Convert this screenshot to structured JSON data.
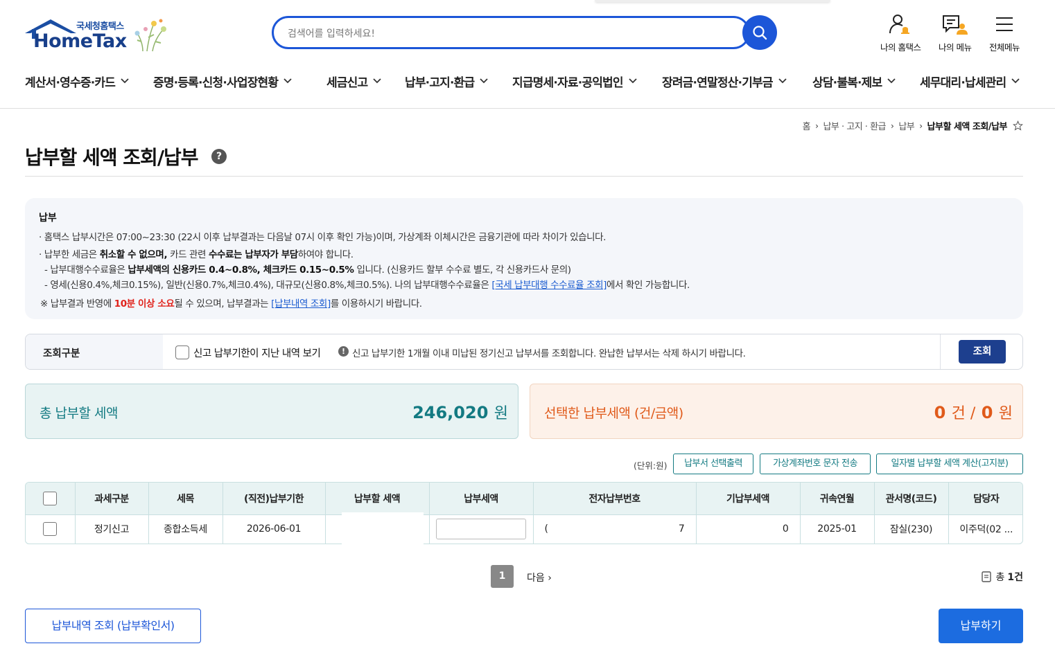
{
  "logo": {
    "sub": "국세청홈택스",
    "main": "HomeTax"
  },
  "search": {
    "placeholder": "검색어를 입력하세요!"
  },
  "util": [
    {
      "label": "나의 홈택스",
      "icon": "user-bell-icon"
    },
    {
      "label": "나의 메뉴",
      "icon": "my-menu-icon"
    },
    {
      "label": "전체메뉴",
      "icon": "hamburger-icon"
    }
  ],
  "gnb": [
    "계산서·영수증·카드",
    "증명·등록·신청·사업장현황",
    "세금신고",
    "납부·고지·환급",
    "지급명세·자료·공익법인",
    "장려금·연말정산·기부금",
    "상담·불복·제보",
    "세무대리·납세관리"
  ],
  "breadcrumb": [
    "홈",
    "납부 · 고지 · 환급",
    "납부",
    "납부할 세액 조회/납부"
  ],
  "page": {
    "title": "납부할 세액 조회/납부"
  },
  "info": {
    "heading": "납부",
    "l1": "홈택스 납부시간은 07:00~23:30 (22시 이후 납부결과는 다음날 07시 이후 확인 가능)이며, 가상계좌 이체시간은 금융기관에 따라 차이가 있습니다.",
    "l2a": "납부한 세금은 ",
    "l2b": "취소할 수 없으며,",
    "l2c": " 카드 관련 ",
    "l2d": "수수료는 납부자가 부담",
    "l2e": "하여야 합니다.",
    "l3a": "- 납부대행수수료율은 ",
    "l3b": "납부세액의 신용카드 0.4~0.8%, 체크카드 0.15~0.5%",
    "l3c": " 입니다. (신용카드 할부 수수료 별도, 각 신용카드사 문의)",
    "l4a": "- 영세(신용0.4%,체크0.15%), 일반(신용0.7%,체크0.4%), 대규모(신용0.8%,체크0.5%). 나의 납부대행수수료율은 ",
    "l4link": "[국세 납부대행 수수료율 조회]",
    "l4b": "에서 확인 가능합니다.",
    "l5a": "※ 납부결과 반영에 ",
    "l5red": "10분 이상 소요",
    "l5b": "될 수 있으며, 납부결과는 ",
    "l5link": "[납부내역 조회]",
    "l5c": "를 이용하시기 바랍니다."
  },
  "cond": {
    "label": "조회구분",
    "checkbox_label": "신고 납부기한이 지난 내역 보기",
    "notice": "신고 납부기한 1개월 이내 미납된 정기신고 납부서를 조회합니다. 완납한 납부서는 삭제 하시기 바랍니다.",
    "button": "조회"
  },
  "summary": {
    "total_label": "총 납부할 세액",
    "total_value": "246,020",
    "total_unit": "원",
    "sel_label": "선택한 납부세액 (건/금액)",
    "sel_count": "0",
    "sel_count_unit": "건 /",
    "sel_amount": "0",
    "sel_amount_unit": "원"
  },
  "actions": {
    "unit": "(단위:원)",
    "btn1": "납부서 선택출력",
    "btn2": "가상계좌번호 문자 전송",
    "btn3": "일자별 납부할 세액 계산(고지분)"
  },
  "table": {
    "headers": [
      "",
      "과세구분",
      "세목",
      "(직전)납부기한",
      "납부할 세액",
      "납부세액",
      "전자납부번호",
      "기납부세액",
      "귀속연월",
      "관서명(코드)",
      "담당자"
    ],
    "rows": [
      {
        "type": "정기신고",
        "tax": "종합소득세",
        "due": "2026-06-01",
        "amount": "",
        "pay": "",
        "epay_start": "(",
        "epay_end": "7",
        "prepaid": "0",
        "period": "2025-01",
        "office": "잠실(230)",
        "staff": "이주덕(02 ..."
      }
    ]
  },
  "pagination": {
    "current": "1",
    "next": "다음",
    "total_prefix": "총",
    "total": "1건"
  },
  "bottom": {
    "history": "납부내역 조회 (납부확인서)",
    "pay": "납부하기"
  },
  "colors": {
    "primary": "#1c56d8",
    "teal": "#137a82",
    "orange": "#e05a1a",
    "navy": "#1d3f8e"
  }
}
